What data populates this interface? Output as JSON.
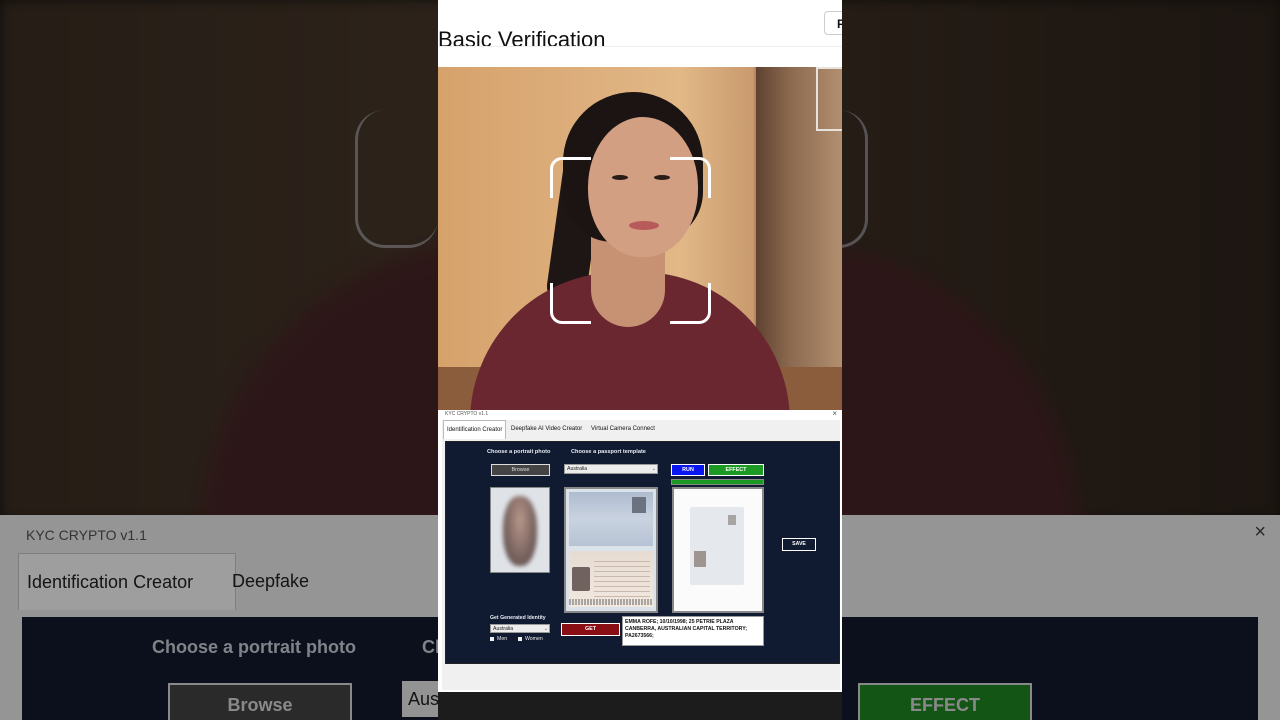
{
  "page": {
    "title": "Basic Verification",
    "top_button_label": "F"
  },
  "app": {
    "window_title": "KYC CRYPTO v1.1",
    "close_glyph": "×",
    "tabs": [
      {
        "label": "Identification Creator",
        "active": true
      },
      {
        "label": "Deepfake AI Video Creator",
        "active": false
      },
      {
        "label": "Virtual Camera Connect",
        "active": false
      }
    ],
    "portrait_label": "Choose a portrait photo",
    "passport_label": "Choose a passport template",
    "browse_label": "Browse",
    "template_country": "Australia",
    "run_label": "RUN",
    "effect_label": "EFFECT",
    "progress_fraction": 1.0,
    "save_label": "SAVE",
    "generated_identity_label": "Get Generated Identity",
    "identity_country": "Australia",
    "men_label": "Men",
    "women_label": "Women",
    "get_label": "GET",
    "identity_text": "EMMA ROFE; 10/10/1998; 25 PETRIE PLAZA CANBERRA, AUSTRALIAN CAPITAL TERRITORY; PA2673566;"
  },
  "background": {
    "window_title": "KYC CRYPTO v1.1",
    "tab1": "Identification Creator",
    "tab2": "Deepfake AI Video Crea",
    "portrait_label": "Choose a portrait photo",
    "passport_label_partial": "Cl",
    "browse_label": "Browse",
    "country_partial": "Aus",
    "effect_label": "EFFECT"
  },
  "colors": {
    "panel_bg": "#101a30",
    "run_blue": "#0a16f0",
    "effect_green": "#1d9a24",
    "get_red": "#8a0f14"
  },
  "icons": [
    "close-icon",
    "dropdown-arrow-icon",
    "face-frame-corner-icon",
    "checkbox-icon"
  ]
}
